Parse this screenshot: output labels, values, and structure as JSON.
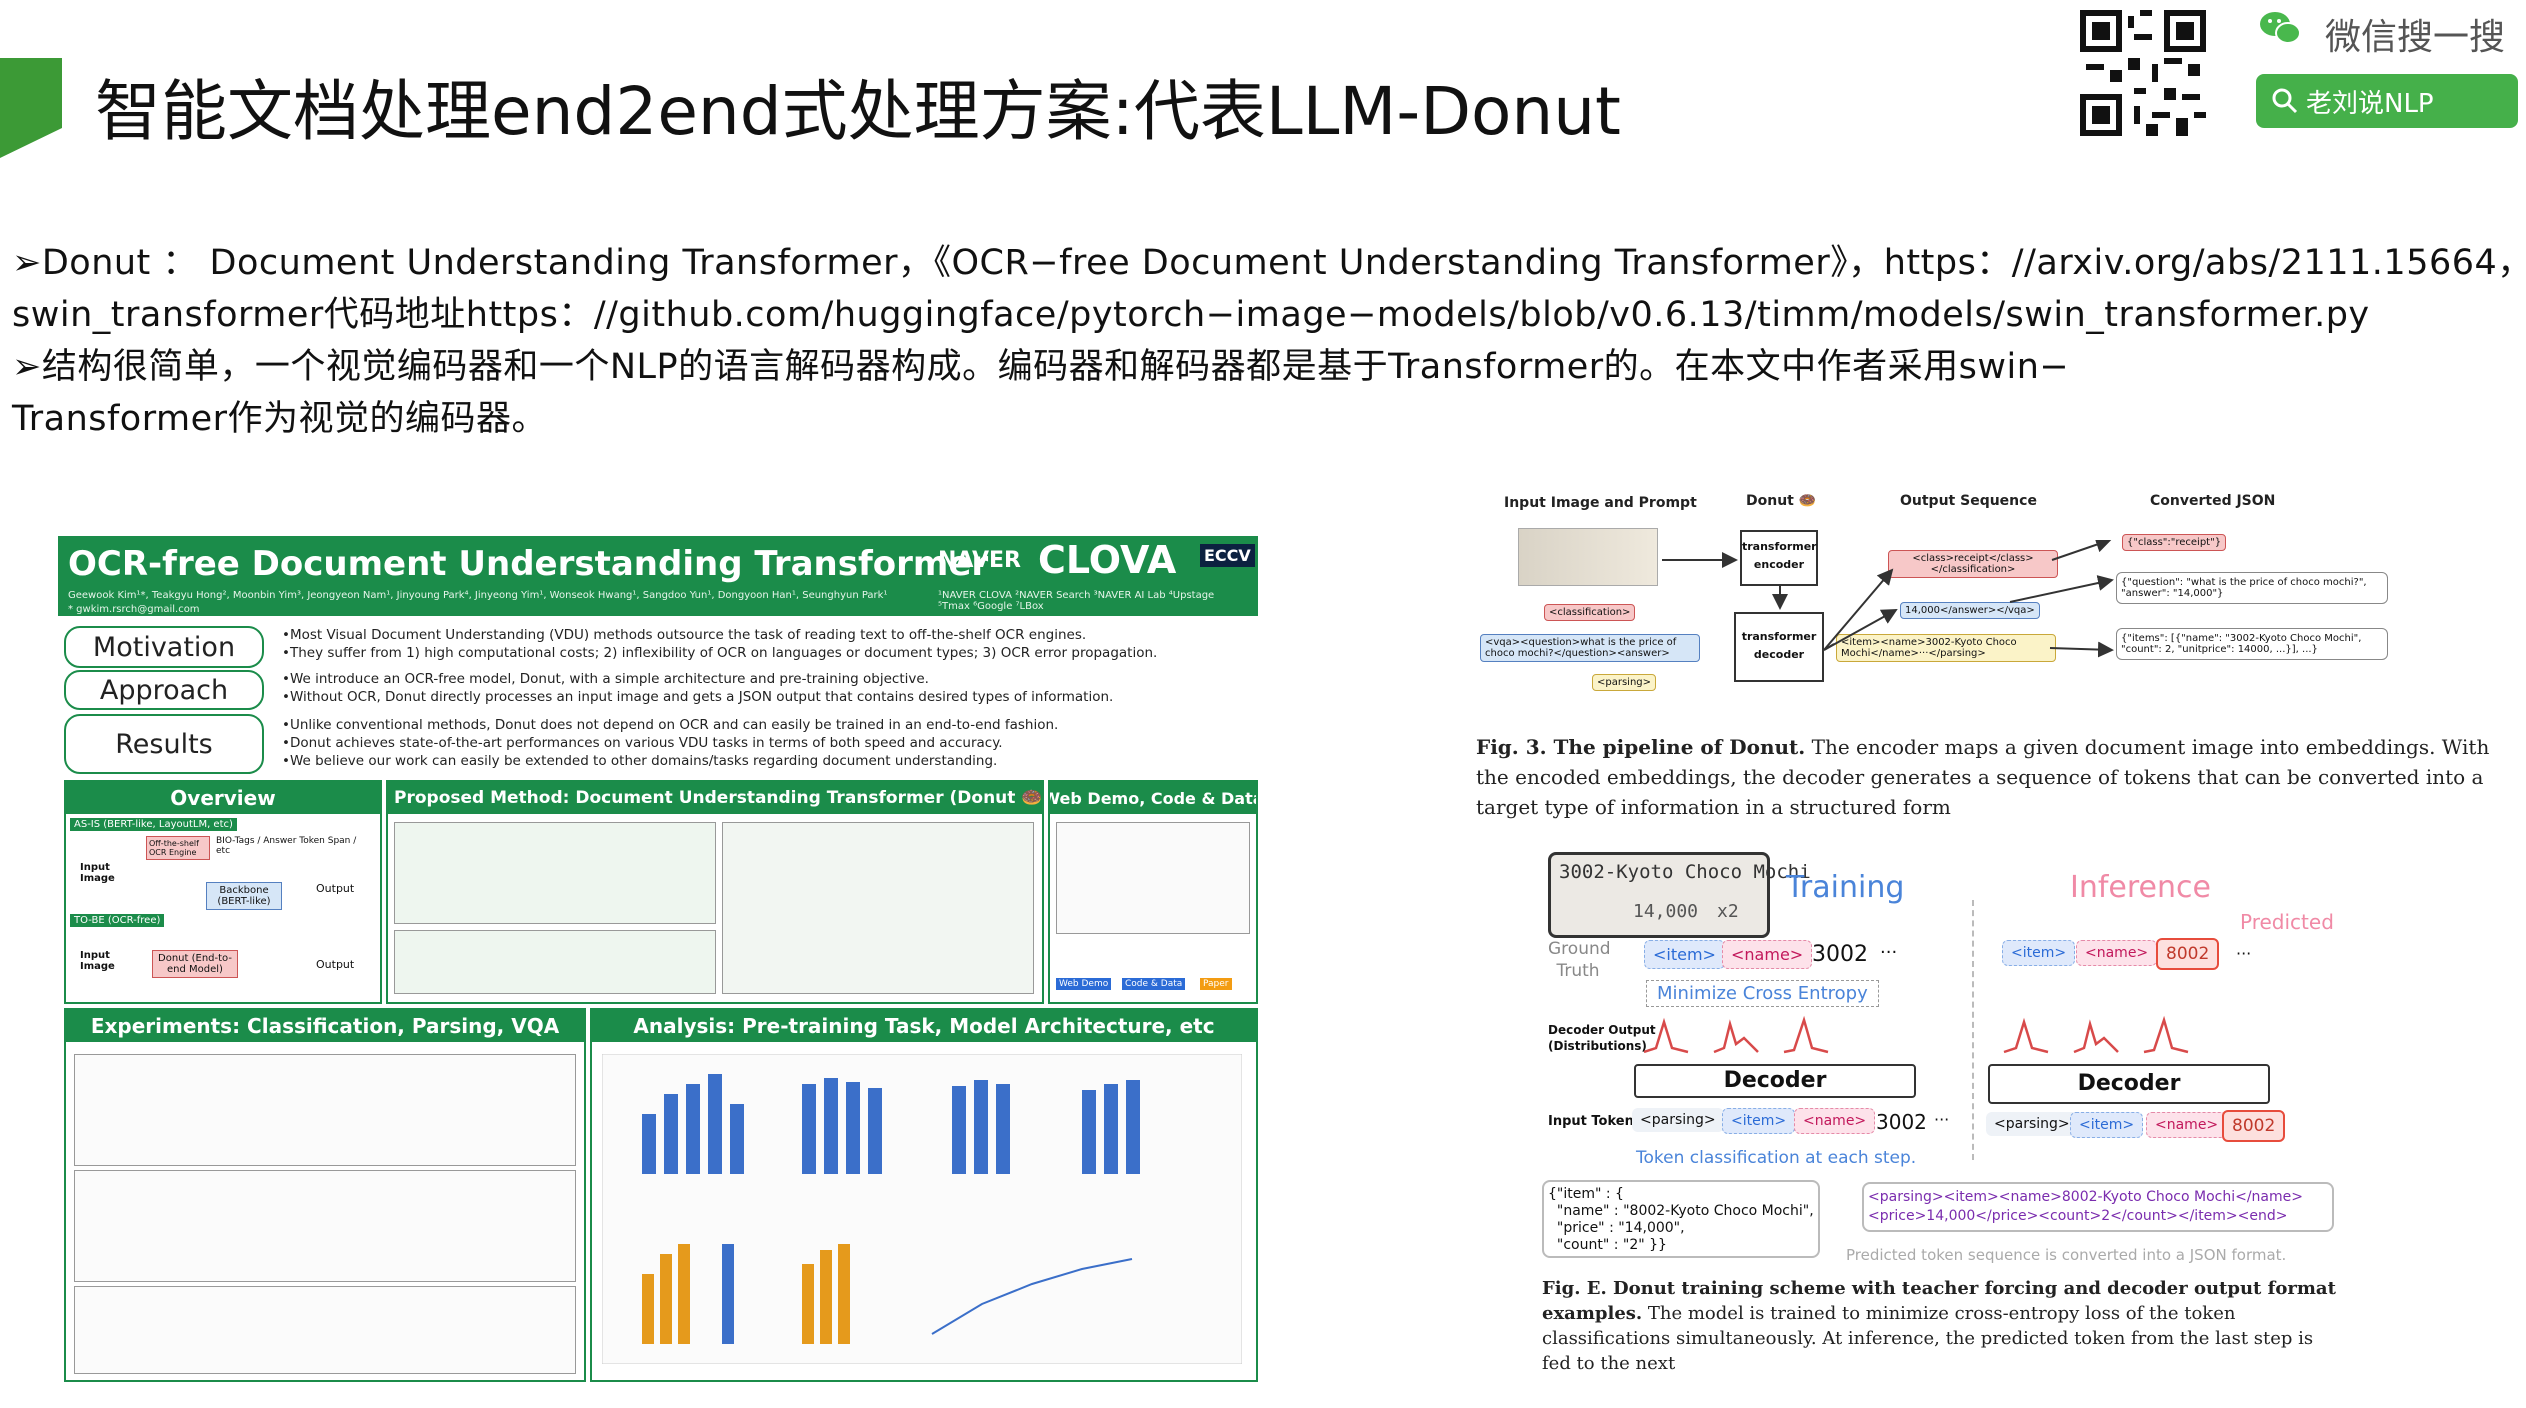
{
  "header": {
    "title": "智能文档处理end2end式处理方案:代表LLM-Donut",
    "accent_color": "#3c9a36"
  },
  "brand": {
    "search_label": "微信搜一搜",
    "account_name": "老刘说NLP",
    "button_color": "#45b04a"
  },
  "body_text": {
    "line1": "➢Donut ： Document Understanding Transformer，《OCR−free Document Understanding Transformer》，https：//arxiv.org/abs/2111.15664，",
    "line2": "swin_transformer代码地址https：//github.com/huggingface/pytorch−image−models/blob/v0.6.13/timm/models/swin_transformer.py",
    "line3": "➢结构很简单，一个视觉编码器和一个NLP的语言解码器构成。编码器和解码器都是基于Transformer的。在本文中作者采用swin−",
    "line4": "Transformer作为视觉的编码器。"
  },
  "poster": {
    "title": "OCR-free Document Understanding Transformer",
    "authors": "Geewook Kim¹*, Teakgyu Hong², Moonbin Yim³, Jeongyeon Nam¹, Jinyoung Park⁴, Jinyeong Yim¹, Wonseok Hwang¹, Sangdoo Yun¹, Dongyoon Han¹, Seunghyun Park¹",
    "email": "* gwkim.rsrch@gmail.com",
    "affiliations": "¹NAVER CLOVA  ²NAVER Search  ³NAVER AI Lab  ⁴Upstage  ⁵Tmax  ⁶Google  ⁷LBox",
    "logo_naver": "NAVER",
    "logo_clova": "CLOVA",
    "logo_eccv": "ECCV",
    "motivation_label": "Motivation",
    "approach_label": "Approach",
    "results_label": "Results",
    "motivation_bullets": [
      "•Most Visual Document Understanding (VDU) methods outsource the task of reading text to off-the-shelf OCR engines.",
      "•They suffer from 1) high computational costs; 2) inflexibility of OCR on languages or document types; 3) OCR error propagation."
    ],
    "approach_bullets": [
      "•We introduce an OCR-free model, Donut, with a simple architecture and pre-training objective.",
      "•Without OCR, Donut directly processes an input image and gets a JSON output that contains desired types of information."
    ],
    "results_bullets": [
      "•Unlike conventional methods, Donut does not depend on OCR and can easily be trained in an end-to-end fashion.",
      "•Donut achieves state-of-the-art performances on various VDU tasks in terms of both speed and accuracy.",
      "•We believe our work can easily be extended to other domains/tasks regarding document understanding."
    ],
    "overview_title": "Overview",
    "overview_asis": "AS-IS (BERT-like, LayoutLM, etc)",
    "overview_tobe": "TO-BE (OCR-free)",
    "overview_input": "Input Image",
    "overview_output": "Output",
    "overview_ocr": "Off-the-shelf OCR Engine",
    "overview_backbone": "Backbone (BERT-like)",
    "overview_donut": "Donut (End-to-end Model)",
    "overview_bio": "BIO-Tags / Answer Token Span / etc",
    "proposed_title": "Proposed Method: Document Understanding Transformer (Donut 🍩)",
    "demo_title": "Web Demo, Code & Data",
    "demo_labels": [
      "Web Demo",
      "Code & Data",
      "Paper"
    ],
    "experiments_title": "Experiments: Classification, Parsing, VQA",
    "analysis_title": "Analysis: Pre-training Task, Model Architecture, etc"
  },
  "fig3": {
    "col_input": "Input Image and Prompt",
    "col_donut": "Donut 🍩",
    "col_output": "Output Sequence",
    "col_json": "Converted JSON",
    "encoder": "transformer encoder",
    "decoder": "transformer decoder",
    "prompt_class": "<classification>",
    "prompt_vqa": "<vqa><question>what is the price of choco mochi?</question><answer>",
    "prompt_parse": "<parsing>",
    "out_class": "<class>receipt</class></classification>",
    "out_vqa": "14,000</answer></vqa>",
    "out_parse": "<item><name>3002-Kyoto Choco Mochi</name>···</parsing>",
    "json_class": "{\"class\":\"receipt\"}",
    "json_vqa": "{\"question\": \"what is the price of choco mochi?\", \"answer\": \"14,000\"}",
    "json_parse": "{\"items\": [{\"name\": \"3002-Kyoto Choco Mochi\", \"count\": 2, \"unitprice\": 14000, ...}], ...}",
    "caption_bold": "Fig. 3. The pipeline of Donut.",
    "caption_text": " The encoder maps a given document image into embeddings. With the encoded embeddings, the decoder generates a sequence of tokens that can be converted into a target type of information in a structured form"
  },
  "figE": {
    "receipt_text": "3002-Kyoto Choco Mochi",
    "receipt_price": "14,000",
    "receipt_qty": "x2",
    "training": "Training",
    "inference": "Inference",
    "predicted": "Predicted",
    "ground_truth": "Ground Truth",
    "gt_tokens": [
      "<item>",
      "<name>",
      "3002",
      "···"
    ],
    "min_ce": "Minimize Cross Entropy",
    "decoder_output": "Decoder Output (Distributions)",
    "decoder": "Decoder",
    "input_tokens_label": "Input Tokens",
    "input_tokens": [
      "<parsing>",
      "<item>",
      "<name>",
      "3002",
      "···"
    ],
    "token_cls": "Token classification at each step.",
    "pred_tokens": [
      "<item>",
      "<name>",
      "8002",
      "···"
    ],
    "inf_tokens": [
      "<parsing>",
      "<item>",
      "<name>",
      "8002"
    ],
    "json_block": "{\"item\" : {\n  \"name\" : \"8002-Kyoto Choco Mochi\",\n  \"price\" : \"14,000\",\n  \"count\" : \"2\" }}",
    "seq_block": "<parsing><item><name>8002-Kyoto Choco Mochi</name>\n<price>14,000</price><count>2</count></item><end>",
    "seq_note": "Predicted token sequence is converted into a JSON format.",
    "caption_bold": "Fig. E. Donut training scheme with teacher forcing and decoder output format examples.",
    "caption_text": " The model is trained to minimize cross-entropy loss of the token classifications simultaneously. At inference, the predicted token from the last step is fed to the next"
  }
}
